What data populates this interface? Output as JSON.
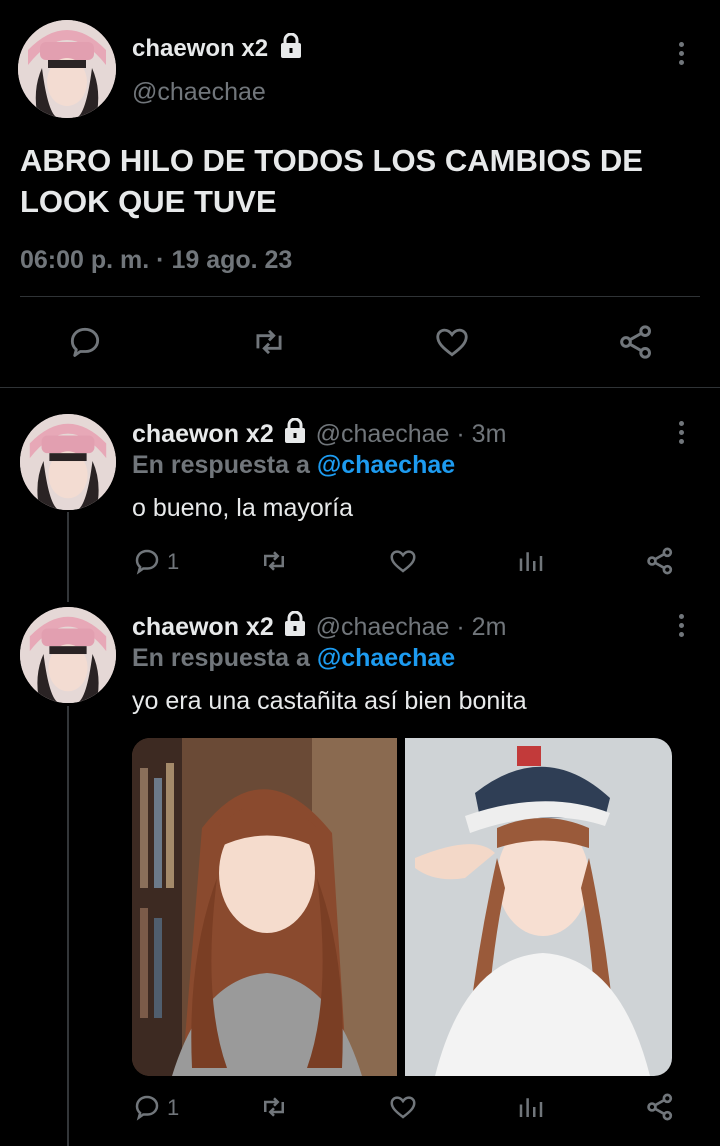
{
  "main_tweet": {
    "display_name": "chaewon x2",
    "handle": "@chaechae",
    "text": "ABRO HILO DE TODOS LOS CAMBIOS DE LOOK QUE TUVE",
    "timestamp": "06:00 p. m. · 19 ago. 23"
  },
  "replies": [
    {
      "display_name": "chaewon x2",
      "handle": "@chaechae",
      "time": "· 3m",
      "reply_prefix": "En respuesta a",
      "reply_to": "@chaechae",
      "text": "o bueno, la mayoría",
      "reply_count": "1"
    },
    {
      "display_name": "chaewon x2",
      "handle": "@chaechae",
      "time": "· 2m",
      "reply_prefix": "En respuesta a",
      "reply_to": "@chaechae",
      "text": "yo era una castañita así bien bonita",
      "reply_count": "1"
    }
  ],
  "colors": {
    "background": "#000000",
    "text": "#e7e9ea",
    "secondary": "#71767b",
    "accent": "#1d9bf0"
  },
  "icons": [
    "lock-icon",
    "more-icon",
    "reply-icon",
    "retweet-icon",
    "like-icon",
    "share-icon",
    "views-icon"
  ]
}
